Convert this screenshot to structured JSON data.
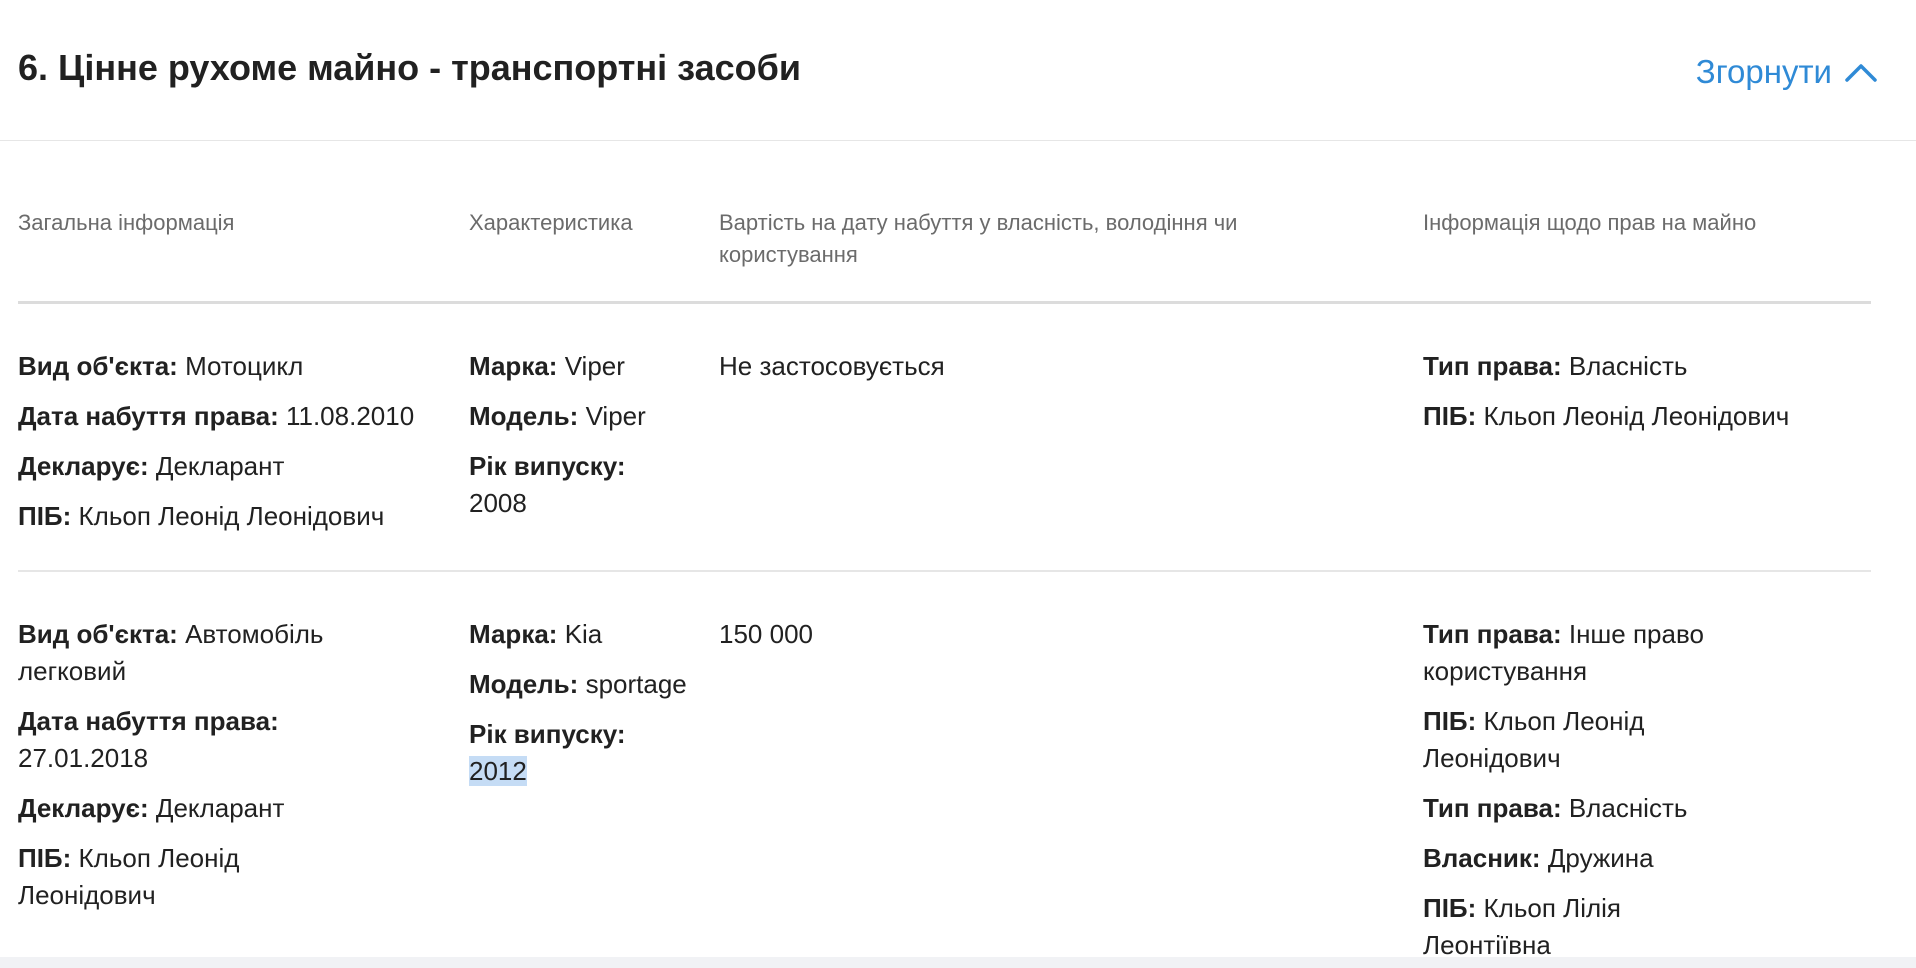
{
  "section": {
    "title": "6. Цінне рухоме майно - транспортні засоби",
    "collapse_label": "Згорнути"
  },
  "columns": [
    "Загальна інформація",
    "Характеристика",
    "Вартість на дату набуття у власність, володіння чи користування",
    "Інформація щодо прав на майно"
  ],
  "rows": [
    {
      "general": {
        "object_type_label": "Вид об'єкта:",
        "object_type": "Мотоцикл",
        "date_label": "Дата набуття права:",
        "date": "11.08.2010",
        "declares_label": "Декларує:",
        "declares": "Декларант",
        "name_label": "ПІБ:",
        "name": "Кльоп Леонід Леонідович"
      },
      "specs": {
        "brand_label": "Марка:",
        "brand": "Viper",
        "model_label": "Модель:",
        "model": "Viper",
        "year_label": "Рік випуску:",
        "year": "2008"
      },
      "value": "Не застосовується",
      "rights": [
        {
          "label": "Тип права:",
          "value": "Власність"
        },
        {
          "label": "ПІБ:",
          "value": "Кльоп Леонід Леонідович"
        }
      ]
    },
    {
      "general": {
        "object_type_label": "Вид об'єкта:",
        "object_type": "Автомобіль легковий",
        "date_label": "Дата набуття права:",
        "date": "27.01.2018",
        "declares_label": "Декларує:",
        "declares": "Декларант",
        "name_label": "ПІБ:",
        "name": "Кльоп Леонід Леонідович"
      },
      "specs": {
        "brand_label": "Марка:",
        "brand": "Kia",
        "model_label": "Модель:",
        "model": "sportage",
        "year_label": "Рік випуску:",
        "year": "2012"
      },
      "value": "150 000",
      "rights": [
        {
          "label": "Тип права:",
          "value": "Інше право користування"
        },
        {
          "label": "ПІБ:",
          "value": "Кльоп Леонід Леонідович"
        },
        {
          "label": "Тип права:",
          "value": "Власність"
        },
        {
          "label": "Власник:",
          "value": "Дружина"
        },
        {
          "label": "ПІБ:",
          "value": "Кльоп Лілія Леонтіївна"
        }
      ]
    }
  ],
  "colors": {
    "accent": "#2f8ad6",
    "text": "#212121",
    "muted": "#6b6b6b",
    "selection": "#c5dcf5"
  },
  "icons": {
    "collapse": "chevron-up-icon"
  }
}
